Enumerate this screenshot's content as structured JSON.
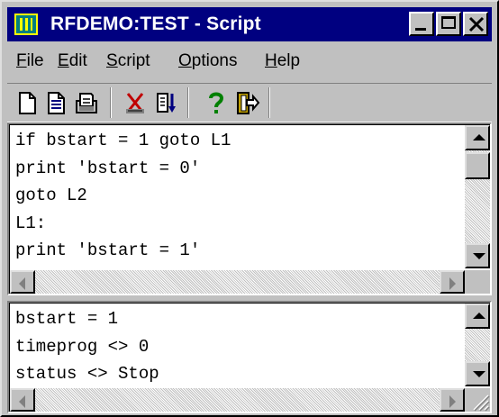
{
  "window": {
    "title": "RFDEMO:TEST - Script",
    "app_icon": "app-icon",
    "caption_buttons": [
      "minimize-icon",
      "maximize-icon",
      "close-icon"
    ]
  },
  "menu": [
    {
      "label": "File",
      "mnemonic": "F",
      "rest": "ile"
    },
    {
      "label": "Edit",
      "mnemonic": "E",
      "rest": "dit"
    },
    {
      "label": "Script",
      "mnemonic": "S",
      "rest": "cript"
    },
    {
      "label": "Options",
      "mnemonic": "O",
      "rest": "ptions"
    },
    {
      "label": "Help",
      "mnemonic": "H",
      "rest": "elp"
    }
  ],
  "toolbar": {
    "buttons": [
      "new-document-icon",
      "open-document-icon",
      "save-icon",
      "cut-icon",
      "run-script-icon",
      "help-icon",
      "exit-icon"
    ]
  },
  "script_pane": {
    "lines": [
      "if bstart = 1 goto L1",
      "print 'bstart = 0'",
      "goto L2",
      "L1:",
      "print 'bstart = 1'"
    ]
  },
  "watch_pane": {
    "lines": [
      "bstart = 1",
      "timeprog <> 0",
      "status <> Stop"
    ]
  },
  "colors": {
    "title_bar": "#000080",
    "face": "#c0c0c0",
    "help_icon": "#008000",
    "cut_icon": "#c00000"
  }
}
